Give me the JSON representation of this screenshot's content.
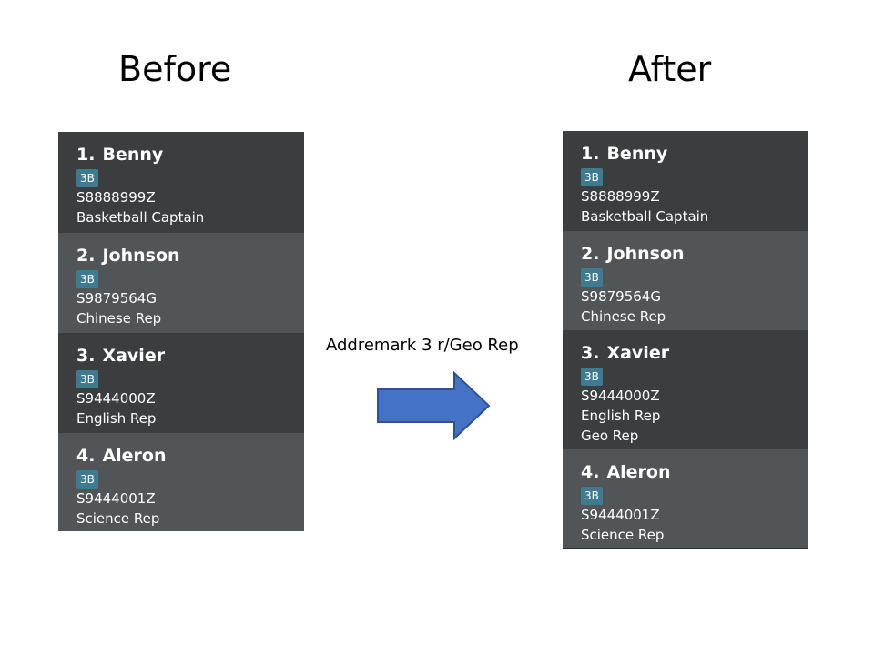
{
  "before_label": "Before",
  "after_label": "After",
  "command": "Addremark 3 r/Geo Rep",
  "before": [
    {
      "index": "1.",
      "name": "Benny",
      "tag": "3B",
      "id": "S8888999Z",
      "remarks": [
        "Basketball Captain"
      ]
    },
    {
      "index": "2.",
      "name": "Johnson",
      "tag": "3B",
      "id": "S9879564G",
      "remarks": [
        "Chinese Rep"
      ]
    },
    {
      "index": "3.",
      "name": "Xavier",
      "tag": "3B",
      "id": "S9444000Z",
      "remarks": [
        "English Rep"
      ]
    },
    {
      "index": "4.",
      "name": "Aleron",
      "tag": "3B",
      "id": "S9444001Z",
      "remarks": [
        "Science Rep"
      ]
    }
  ],
  "after": [
    {
      "index": "1.",
      "name": "Benny",
      "tag": "3B",
      "id": "S8888999Z",
      "remarks": [
        "Basketball Captain"
      ]
    },
    {
      "index": "2.",
      "name": "Johnson",
      "tag": "3B",
      "id": "S9879564G",
      "remarks": [
        "Chinese Rep"
      ]
    },
    {
      "index": "3.",
      "name": "Xavier",
      "tag": "3B",
      "id": "S9444000Z",
      "remarks": [
        "English Rep",
        "Geo Rep"
      ]
    },
    {
      "index": "4.",
      "name": "Aleron",
      "tag": "3B",
      "id": "S9444001Z",
      "remarks": [
        "Science Rep"
      ]
    }
  ],
  "colors": {
    "card_dark": "#3c3d3f",
    "card_light": "#515558",
    "tag": "#3e7b91",
    "arrow_fill": "#4472c4",
    "arrow_stroke": "#2f528f"
  },
  "icons": {
    "arrow": "right-arrow-icon"
  }
}
